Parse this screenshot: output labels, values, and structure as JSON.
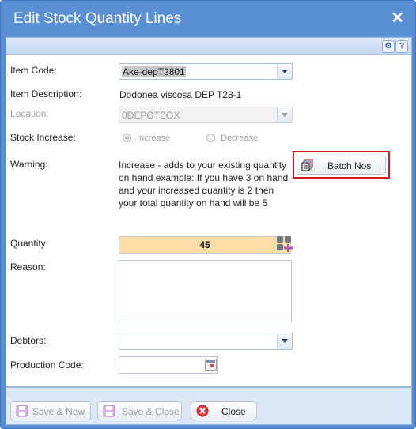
{
  "window": {
    "title": "Edit Stock Quantity Lines"
  },
  "toolbar": {
    "gear_icon": "gear-icon",
    "help_label": "?"
  },
  "form": {
    "item_code_label": "Item Code:",
    "item_code_value": "Ake-depT2801",
    "item_description_label": "Item Description:",
    "item_description_value": "Dodonea viscosa DEP T28-1",
    "location_label": "Location:",
    "location_value": "0DEPOTBOX",
    "stock_increase_label": "Stock Increase:",
    "increase_option": "Increase",
    "decrease_option": "Decrease",
    "warning_label": "Warning:",
    "warning_text": "Increase - adds to your existing quantity on hand example: If you have 3 on hand and your increased quantity is 2 then your total quantity on hand will be 5",
    "batch_button": "Batch Nos",
    "quantity_label": "Quantity:",
    "quantity_value": "45",
    "reason_label": "Reason:",
    "reason_value": "",
    "debtors_label": "Debtors:",
    "debtors_value": "",
    "production_code_label": "Production Code:",
    "production_code_value": ""
  },
  "footer": {
    "save_new": "Save & New",
    "save_close": "Save & Close",
    "close": "Close"
  },
  "colors": {
    "title_bar": "#5b8fd4",
    "quantity_bg": "#ffdea6",
    "highlight_border": "#d51a1a"
  }
}
